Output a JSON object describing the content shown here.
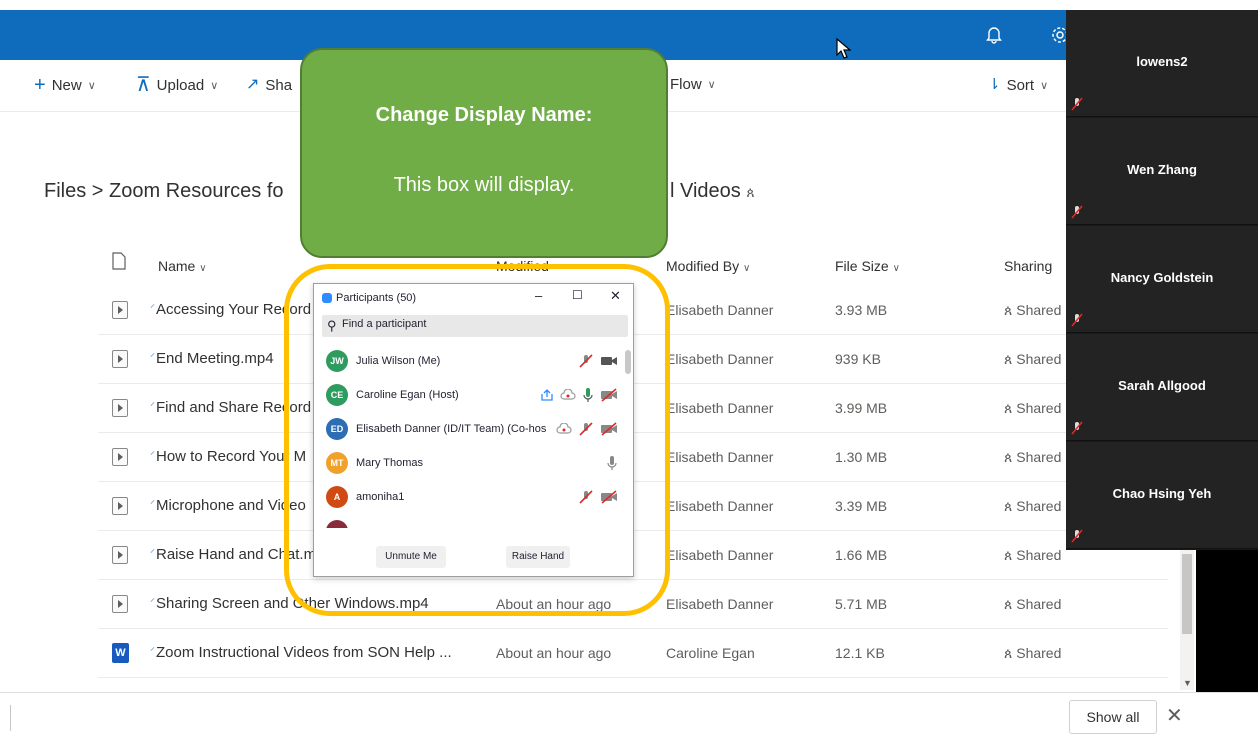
{
  "header": {
    "icons": [
      "bell-icon",
      "gear-icon"
    ],
    "brand_color": "#0f6cbd"
  },
  "commands": {
    "new_label": "New",
    "upload_label": "Upload",
    "share_label": "Sha",
    "flow_label": "Flow",
    "sort_label": "Sort"
  },
  "breadcrumb": {
    "part1": "Files  >  Zoom Resources fo",
    "part2": "l Videos"
  },
  "columns": {
    "name": "Name",
    "modified": "Modified",
    "modified_by": "Modified By",
    "file_size": "File Size",
    "sharing": "Sharing"
  },
  "files": [
    {
      "name": "Accessing Your Record",
      "modified": "",
      "modified_by": "Elisabeth Danner",
      "size": "3.93 MB",
      "sharing": "Shared",
      "type": "video"
    },
    {
      "name": "End Meeting.mp4",
      "modified": "",
      "modified_by": "Elisabeth Danner",
      "size": "939 KB",
      "sharing": "Shared",
      "type": "video"
    },
    {
      "name": "Find and Share Record",
      "modified": "",
      "modified_by": "Elisabeth Danner",
      "size": "3.99 MB",
      "sharing": "Shared",
      "type": "video"
    },
    {
      "name": "How to Record Your M",
      "modified": "",
      "modified_by": "Elisabeth Danner",
      "size": "1.30 MB",
      "sharing": "Shared",
      "type": "video"
    },
    {
      "name": "Microphone and Video",
      "modified": "",
      "modified_by": "Elisabeth Danner",
      "size": "3.39 MB",
      "sharing": "Shared",
      "type": "video"
    },
    {
      "name": "Raise Hand and Chat.m",
      "modified": "",
      "modified_by": "Elisabeth Danner",
      "size": "1.66 MB",
      "sharing": "Shared",
      "type": "video"
    },
    {
      "name": "Sharing Screen and Other Windows.mp4",
      "modified": "About an hour ago",
      "modified_by": "Elisabeth Danner",
      "size": "5.71 MB",
      "sharing": "Shared",
      "type": "video"
    },
    {
      "name": "Zoom Instructional Videos from SON Help ...",
      "modified": "About an hour ago",
      "modified_by": "Caroline Egan",
      "size": "12.1 KB",
      "sharing": "Shared",
      "type": "word"
    }
  ],
  "bottom_bar": {
    "show_all_label": "Show all",
    "close_label": "✕"
  },
  "video_strip": {
    "participants": [
      "lowens2",
      "Wen Zhang",
      "Nancy Goldstein",
      "Sarah Allgood",
      "Chao Hsing Yeh"
    ]
  },
  "callout": {
    "title": "Change Display Name:",
    "body": "This box will display.",
    "fill_color": "#70ad47",
    "ring_color": "#ffc000"
  },
  "participants_panel": {
    "title": "Participants (50)",
    "search_placeholder": "Find a participant",
    "people": [
      {
        "initials": "JW",
        "name": "Julia Wilson (Me)",
        "color": "#2e9b5f",
        "icons": [
          "mic-muted-icon",
          "video-icon"
        ]
      },
      {
        "initials": "CE",
        "name": "Caroline Egan (Host)",
        "color": "#2e9b5f",
        "icons": [
          "share-screen-icon",
          "cloud-record-icon",
          "mic-active-icon",
          "video-off-icon"
        ]
      },
      {
        "initials": "ED",
        "name": "Elisabeth Danner (ID/IT Team) (Co-host)",
        "color": "#2d6db3",
        "icons": [
          "cloud-record-icon",
          "mic-muted-icon",
          "video-off-icon"
        ]
      },
      {
        "initials": "MT",
        "name": "Mary Thomas",
        "color": "#f0a12b",
        "icons": [
          "mic-icon"
        ]
      },
      {
        "initials": "A",
        "name": "amoniha1",
        "color": "#d04a13",
        "icons": [
          "mic-muted-icon",
          "video-off-icon"
        ]
      }
    ],
    "unmute_label": "Unmute Me",
    "raise_hand_label": "Raise Hand"
  }
}
